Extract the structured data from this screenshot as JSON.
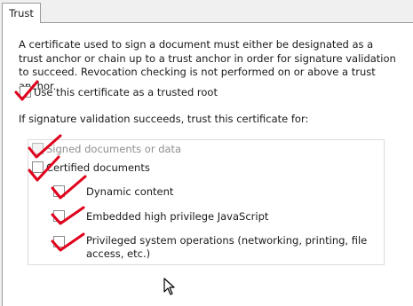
{
  "tab": {
    "label": "Trust"
  },
  "description": "A certificate used to sign a document must either be designated as a trust anchor or chain up to a trust anchor in order for signature validation to succeed.  Revocation checking is not performed on or above a trust anchor.",
  "trusted_root": {
    "label": "Use this certificate as a trusted root",
    "checked": true
  },
  "trust_for_heading": "If signature validation succeeds, trust this certificate for:",
  "options": {
    "signed_docs": {
      "label": "Signed documents or data",
      "checked": true,
      "enabled": false
    },
    "certified_docs": {
      "label": "Certified documents",
      "checked": true,
      "enabled": true
    },
    "dynamic": {
      "label": "Dynamic content",
      "checked": true,
      "enabled": true
    },
    "javascript": {
      "label": "Embedded high privilege JavaScript",
      "checked": true,
      "enabled": true
    },
    "system_ops": {
      "label": "Privileged system operations (networking, printing, file",
      "label_line2": "access, etc.)",
      "checked": true,
      "enabled": true
    }
  },
  "annotation_color": "#e0001b",
  "cursor_icon": "pointer-arrow"
}
